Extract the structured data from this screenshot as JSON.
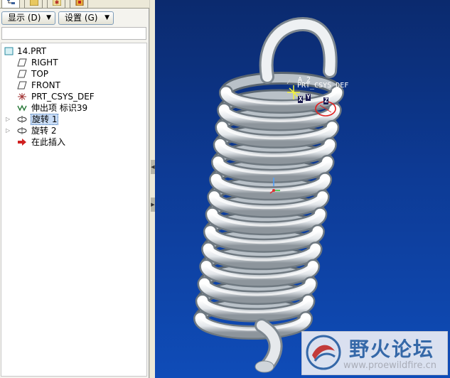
{
  "toolbar": {
    "display_menu": "显示 (D)",
    "settings_menu": "设置 (G)"
  },
  "filter": {
    "placeholder": ""
  },
  "tree": {
    "root": "14.PRT",
    "items": [
      {
        "label": "RIGHT",
        "icon": "datum-plane-icon"
      },
      {
        "label": "TOP",
        "icon": "datum-plane-icon"
      },
      {
        "label": "FRONT",
        "icon": "datum-plane-icon"
      },
      {
        "label": "PRT_CSYS_DEF",
        "icon": "coordinate-system-icon"
      },
      {
        "label": "伸出项 标识39",
        "icon": "extrude-icon"
      },
      {
        "label": "旋转 1",
        "icon": "revolve-icon",
        "selected": true,
        "expandable": true
      },
      {
        "label": "旋转 2",
        "icon": "revolve-icon",
        "expandable": true
      },
      {
        "label": "在此插入",
        "icon": "insert-here-arrow-icon"
      }
    ]
  },
  "viewport": {
    "csys_label": "PRT_CSYS_DEF",
    "axis_label": "A_2",
    "axis_tags": [
      "X",
      "Y",
      "Z"
    ]
  },
  "watermark": {
    "title": "野火论坛",
    "url": "www.proewildfire.cn"
  },
  "colors": {
    "viewport_top": "#0b2a6e",
    "viewport_bottom": "#0f4cb8",
    "spring": "#e8ebee",
    "selection": "#c8dcf6"
  }
}
